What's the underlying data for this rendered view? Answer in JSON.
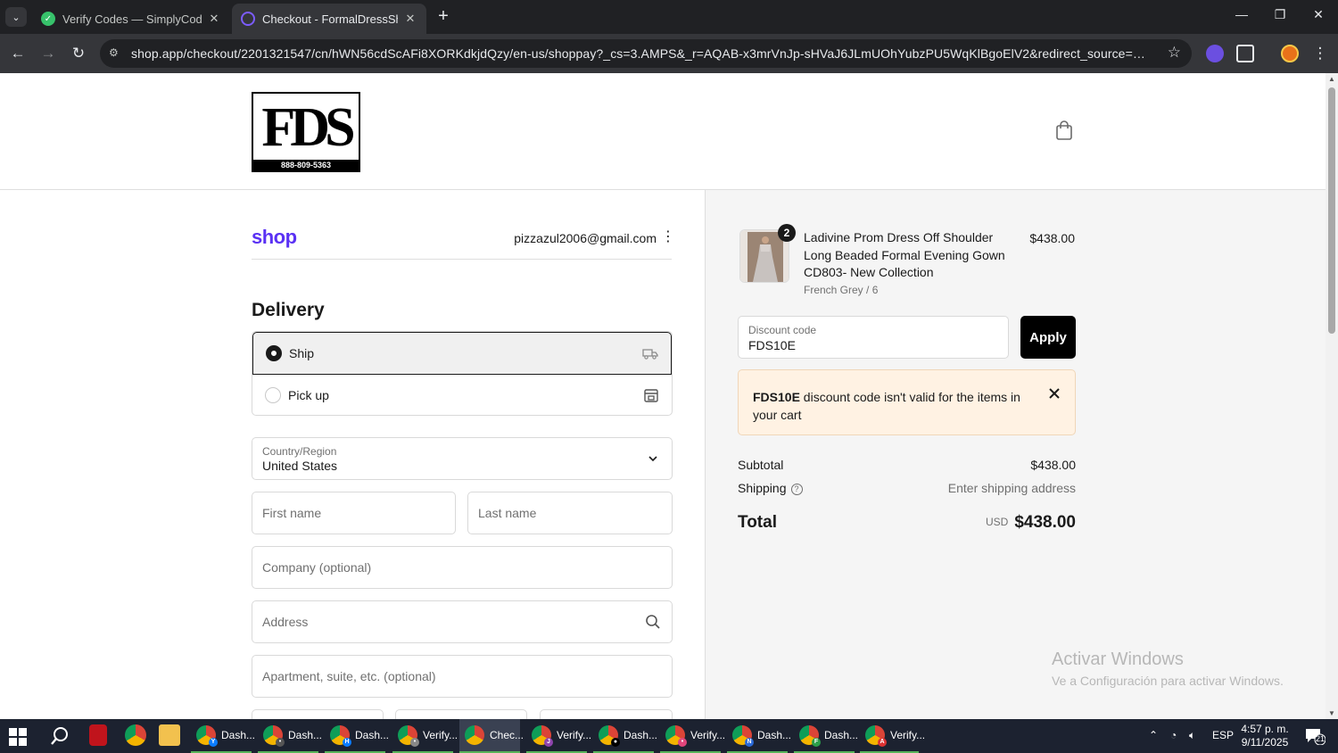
{
  "browser": {
    "tabs": [
      {
        "title": "Verify Codes — SimplyCodes",
        "active": false
      },
      {
        "title": "Checkout - FormalDressShops.c",
        "active": true
      }
    ],
    "url": "shop.app/checkout/2201321547/cn/hWN56cdScAFi8XORKdkjdQzy/en-us/shoppay?_cs=3.AMPS&_r=AQAB-x3mrVnJp-sHVaJ6JLmUOhYubzPU5WqKlBgoElV2&redirect_source=direct_checkout_cart..."
  },
  "store": {
    "logo_text": "FDS",
    "phone": "888-809-5363"
  },
  "account": {
    "shop_logo": "shop",
    "email": "pizzazul2006@gmail.com"
  },
  "delivery": {
    "heading": "Delivery",
    "options": [
      {
        "label": "Ship",
        "selected": true
      },
      {
        "label": "Pick up",
        "selected": false
      }
    ],
    "country_label": "Country/Region",
    "country_value": "United States",
    "first_name_placeholder": "First name",
    "last_name_placeholder": "Last name",
    "company_placeholder": "Company (optional)",
    "address_placeholder": "Address",
    "apartment_placeholder": "Apartment, suite, etc. (optional)"
  },
  "order": {
    "product": {
      "quantity": "2",
      "name": "Ladivine Prom Dress Off Shoulder Long Beaded Formal Evening Gown CD803- New Collection",
      "variant": "French Grey / 6",
      "price": "$438.00"
    },
    "discount_label": "Discount code",
    "discount_value": "FDS10E",
    "apply_label": "Apply",
    "alert_code": "FDS10E",
    "alert_text": " discount code isn't valid for the items in your cart",
    "subtotal_label": "Subtotal",
    "subtotal_value": "$438.00",
    "shipping_label": "Shipping",
    "shipping_value": "Enter shipping address",
    "total_label": "Total",
    "currency": "USD",
    "total_value": "$438.00"
  },
  "watermark": {
    "line1": "Activar Windows",
    "line2": "Ve a Configuración para activar Windows."
  },
  "taskbar": {
    "items": [
      {
        "label": "Dash...",
        "badge": "Y",
        "badge_color": "#0a7cff"
      },
      {
        "label": "Dash...",
        "badge": "•",
        "badge_color": "#555"
      },
      {
        "label": "Dash...",
        "badge": "H",
        "badge_color": "#0a7cff"
      },
      {
        "label": "Verify...",
        "badge": "•",
        "badge_color": "#888"
      },
      {
        "label": "Chec...",
        "badge": "",
        "badge_color": ""
      },
      {
        "label": "Verify...",
        "badge": "J",
        "badge_color": "#8e44ad"
      },
      {
        "label": "Dash...",
        "badge": "●",
        "badge_color": "#000"
      },
      {
        "label": "Verify...",
        "badge": "•",
        "badge_color": "#e0457b"
      },
      {
        "label": "Dash...",
        "badge": "N",
        "badge_color": "#2a6ad8"
      },
      {
        "label": "Dash...",
        "badge": "F",
        "badge_color": "#2a9d4a"
      },
      {
        "label": "Verify...",
        "badge": "A",
        "badge_color": "#d33"
      }
    ],
    "language": "ESP",
    "time": "4:57 p. m.",
    "date": "9/11/2025",
    "notifications": "21"
  }
}
